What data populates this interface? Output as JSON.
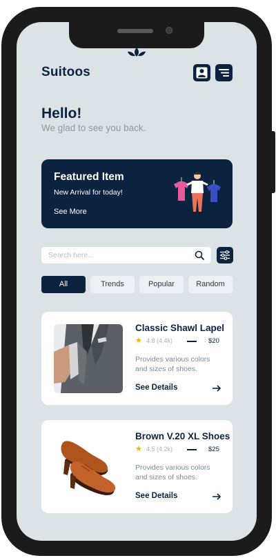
{
  "app": {
    "brand": "Suitoos",
    "greeting_title": "Hello!",
    "greeting_subtitle": "We glad to see you back."
  },
  "header": {
    "profile_icon": "user-icon",
    "menu_icon": "menu-lines-icon"
  },
  "featured": {
    "title": "Featured Item",
    "subtitle": "New Arrival for today!",
    "cta": "See More"
  },
  "search": {
    "placeholder": "Search here...",
    "value": ""
  },
  "tabs": [
    {
      "label": "All",
      "active": true
    },
    {
      "label": "Trends",
      "active": false
    },
    {
      "label": "Popular",
      "active": false
    },
    {
      "label": "Random",
      "active": false
    }
  ],
  "products": [
    {
      "title": "Classic Shawl Lapel",
      "rating": "4.8 (4.4k)",
      "price": "$20",
      "description": "Provides various colors and sizes of shoes.",
      "cta": "See Details",
      "image": "suit-photo"
    },
    {
      "title": "Brown V.20 XL Shoes",
      "rating": "4.5 (4.2k)",
      "price": "$25",
      "description": "Provides various colors and sizes of shoes.",
      "cta": "See Details",
      "image": "brown-shoes-photo"
    }
  ],
  "colors": {
    "primary": "#0c2340",
    "background": "#dce3e7",
    "star": "#f4b400"
  }
}
